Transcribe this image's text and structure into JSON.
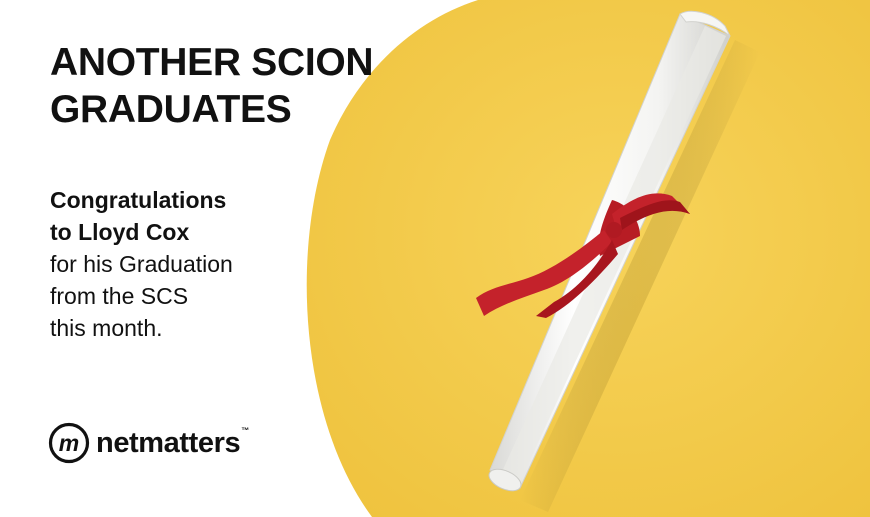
{
  "headline": {
    "line1": "ANOTHER SCION",
    "line2": "GRADUATES"
  },
  "message": {
    "line1": "Congratulations",
    "line2": "to Lloyd Cox",
    "line3": "for his Graduation",
    "line4": "from the SCS",
    "line5": "this month."
  },
  "logo": {
    "mark": "m",
    "wordmark": "netmatters",
    "trademark": "™"
  },
  "colors": {
    "background": "#ffffff",
    "yellow": "#f4cb4b",
    "ribbon": "#c4222b",
    "text": "#111111"
  },
  "icons": [
    "netmatters-logo-icon",
    "diploma-scroll-image"
  ]
}
